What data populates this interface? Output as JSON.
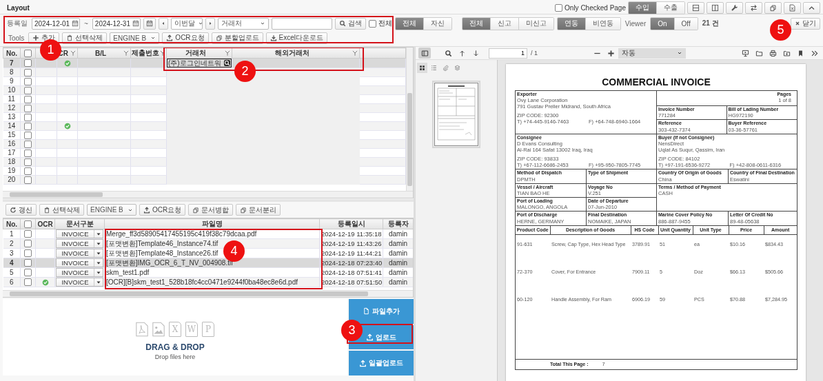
{
  "window": {
    "title": "Layout"
  },
  "top_right": {
    "only_checked": {
      "label": "Only Checked Page",
      "checked": false
    },
    "trade_toggle": [
      {
        "label": "수입",
        "selected": true
      },
      {
        "label": "수출",
        "selected": false
      }
    ]
  },
  "filter_bar": {
    "date_label": "등록일",
    "date_from": "2024-12-01",
    "separator": "~",
    "date_to": "2024-12-31",
    "period": "이번달",
    "partner_select": "거래처",
    "search_button": "검색",
    "all_checkbox": {
      "label": "전체",
      "checked": false
    },
    "scope_toggle": [
      {
        "label": "전체",
        "selected": true
      },
      {
        "label": "자신",
        "selected": false
      }
    ],
    "report_toggle": [
      {
        "label": "전체",
        "selected": true
      },
      {
        "label": "신고",
        "selected": false
      },
      {
        "label": "미신고",
        "selected": false
      }
    ],
    "link_toggle": [
      {
        "label": "연동",
        "selected": true
      },
      {
        "label": "비연동",
        "selected": false
      }
    ],
    "viewer_label": "Viewer",
    "viewer_toggle": [
      {
        "label": "On",
        "selected": true
      },
      {
        "label": "Off",
        "selected": false
      }
    ],
    "count": "21 건"
  },
  "close_button": "닫기",
  "tools": {
    "label": "Tools",
    "buttons": [
      {
        "kind": "button",
        "label": "추가"
      },
      {
        "kind": "button",
        "label": "선택삭제"
      },
      {
        "kind": "select",
        "label": "ENGINE B"
      },
      {
        "kind": "button",
        "label": "OCR요청"
      },
      {
        "kind": "button",
        "label": "분할업로드"
      },
      {
        "kind": "button",
        "label": "Excel다운로드"
      }
    ]
  },
  "upper_grid": {
    "header_checked": false,
    "columns": [
      {
        "label": "No.",
        "filter": false
      },
      {},
      {
        "label": "CR",
        "filter": true
      },
      {
        "label": "B/L",
        "filter": true
      },
      {
        "label": "제출번호",
        "filter": true
      },
      {
        "label": "거래처",
        "filter": true
      },
      {
        "label": "해외거래처",
        "filter": true
      }
    ],
    "rows": [
      {
        "no": "7",
        "selected": true,
        "checked": false,
        "ocr_done": true,
        "partner": "(주)로그인네트워"
      },
      {
        "no": "8",
        "selected": false,
        "checked": false,
        "ocr_done": false
      },
      {
        "no": "9",
        "selected": false,
        "checked": false,
        "ocr_done": false
      },
      {
        "no": "10",
        "selected": false,
        "checked": false,
        "ocr_done": false
      },
      {
        "no": "11",
        "selected": false,
        "checked": false,
        "ocr_done": false
      },
      {
        "no": "12",
        "selected": false,
        "checked": false,
        "ocr_done": false
      },
      {
        "no": "13",
        "selected": false,
        "checked": false,
        "ocr_done": false
      },
      {
        "no": "14",
        "selected": false,
        "checked": false,
        "ocr_done": true
      },
      {
        "no": "15",
        "selected": false,
        "checked": false,
        "ocr_done": false
      },
      {
        "no": "16",
        "selected": false,
        "checked": false,
        "ocr_done": false
      },
      {
        "no": "17",
        "selected": false,
        "checked": false,
        "ocr_done": false
      },
      {
        "no": "18",
        "selected": false,
        "checked": false,
        "ocr_done": false
      },
      {
        "no": "19",
        "selected": false,
        "checked": false,
        "ocr_done": false
      },
      {
        "no": "20",
        "selected": false,
        "checked": false,
        "ocr_done": false
      }
    ]
  },
  "file_toolbar": {
    "buttons": [
      {
        "kind": "button",
        "label": "갱신"
      },
      {
        "kind": "button",
        "label": "선택삭제"
      },
      {
        "kind": "select",
        "label": "ENGINE B"
      },
      {
        "kind": "button",
        "label": "OCR요청"
      },
      {
        "kind": "button",
        "label": "문서병합"
      },
      {
        "kind": "button",
        "label": "문서분리"
      }
    ]
  },
  "file_grid": {
    "header_checked": false,
    "columns": [
      "No.",
      "OCR",
      "문서구분",
      "파일명",
      "등록일시",
      "등록자"
    ],
    "rows": [
      {
        "no": "1",
        "selected": false,
        "checked": false,
        "ocr_done": false,
        "doc_type": "INVOICE",
        "file": "Merge_ff3d58905417455195c419f38c79dcaa.pdf",
        "date": "2024-12-19 11:35:18",
        "user": "damin"
      },
      {
        "no": "2",
        "selected": false,
        "checked": false,
        "ocr_done": false,
        "doc_type": "INVOICE",
        "file": "[포맷변환]Template46_Instance74.tif",
        "date": "2024-12-19 11:43:26",
        "user": "damin"
      },
      {
        "no": "3",
        "selected": false,
        "checked": false,
        "ocr_done": false,
        "doc_type": "INVOICE",
        "file": "[포맷변환]Template48_Instance26.tif",
        "date": "2024-12-19 11:44:21",
        "user": "damin"
      },
      {
        "no": "4",
        "selected": true,
        "checked": false,
        "ocr_done": false,
        "doc_type": "INVOICE",
        "file": "[포맷변환]IMG_OCR_6_T_NV_004908.tif",
        "date": "2024-12-18 07:23:40",
        "user": "damin"
      },
      {
        "no": "5",
        "selected": false,
        "checked": false,
        "ocr_done": false,
        "doc_type": "INVOICE",
        "file": "skm_test1.pdf",
        "date": "2024-12-18 07:51:41",
        "user": "damin"
      },
      {
        "no": "6",
        "selected": false,
        "checked": false,
        "ocr_done": true,
        "doc_type": "INVOICE",
        "file": "[OCR][B]skm_test1_528b18fc4cc0471e9244f0ba48ec8e6d.pdf",
        "date": "2024-12-18 07:51:50",
        "user": "damin"
      }
    ]
  },
  "drop_zone": {
    "file_types": [
      {
        "kind": "pdf"
      },
      {
        "kind": "image"
      },
      {
        "kind": "letter",
        "letter": "X"
      },
      {
        "kind": "letter",
        "letter": "W"
      },
      {
        "kind": "letter",
        "letter": "P"
      }
    ],
    "title": "DRAG & DROP",
    "hint": "Drop files here"
  },
  "side_buttons": [
    "파일추가",
    "업로드",
    "일괄업로드"
  ],
  "viewer": {
    "sidebar_open": true,
    "page": "1",
    "page_total": "/ 1",
    "zoom": "자동",
    "sidebar_tabs": [
      {
        "kind": "thumbnails",
        "selected": true
      },
      {
        "kind": "outline",
        "selected": false
      },
      {
        "kind": "attachments",
        "selected": false
      },
      {
        "kind": "layers",
        "selected": false
      }
    ]
  },
  "invoice": {
    "title": "COMMERCIAL INVOICE",
    "exporter": {
      "label": "Exporter",
      "lines": [
        "Ovy Lane Corporation",
        "791 Gustav Preller Midrand, South Africa"
      ],
      "zip": "ZIP CODE: 92300",
      "tel": "T) +74-445-9146-7463",
      "fax": "F) +64-748-6940-1664"
    },
    "pages": {
      "label": "Pages",
      "value": "1 of 8"
    },
    "invoice_number": {
      "label": "Invoice Number",
      "value": "771284"
    },
    "bill_of_lading": {
      "label": "Bill of Lading Number",
      "value": "HG972190"
    },
    "reference": {
      "label": "Reference",
      "value": "303-432-7374"
    },
    "buyer_reference": {
      "label": "Buyer Reference",
      "value": "03-36-57761"
    },
    "consignee": {
      "label": "Consignee",
      "lines": [
        "D Evans Consulting",
        "Al-Rai 164 Safat 13002 Iraq, Iraq"
      ],
      "zip": "ZIP CODE: 93833",
      "tel": "T) +67-112-6686-2453",
      "fax": "F) +95-950-7805-7745"
    },
    "buyer": {
      "label": "Buyer (If not Consignee)",
      "lines": [
        "NensDirect",
        "Uqlat As Suqur, Qassim, Iran"
      ],
      "zip": "ZIP CODE: 84102",
      "tel": "T) +97-191-6536-9272",
      "fax": "F) +42-808-0611-6316"
    },
    "method_of_dispatch": {
      "label": "Method of Dispatch",
      "value": "DPMTH"
    },
    "type_of_shipment": {
      "label": "Type of Shipment"
    },
    "country_of_origin": {
      "label": "Country Of Origin of Goods",
      "value": "China"
    },
    "country_of_destination": {
      "label": "Country of Final Destination",
      "value": "Eswatini"
    },
    "vessel": {
      "label": "Vessel / Aircraft",
      "value": "TIAN BAO HE"
    },
    "voyage_no": {
      "label": "Voyage No",
      "value": "V.251"
    },
    "terms_of_payment": {
      "label": "Terms / Method of Payment",
      "value": "CASH"
    },
    "port_of_loading": {
      "label": "Port of Loading",
      "value": "MALONGO, ANGOLA"
    },
    "date_of_departure": {
      "label": "Date of Departure",
      "value": "07-Jun-2010"
    },
    "port_of_discharge": {
      "label": "Port of Discharge",
      "value": "HERNE, GERMANY"
    },
    "final_destination": {
      "label": "Final Destination",
      "value": "NOMAIKE, JAPAN"
    },
    "marine_cover_policy": {
      "label": "Marine Cover Policy No",
      "value": "886-887-9455"
    },
    "letter_of_credit": {
      "label": "Letter Of Credit No",
      "value": "89-48-05638"
    },
    "columns": [
      "Product Code",
      "Description of Goods",
      "HS Code",
      "Unit Quantity",
      "Unit Type",
      "Price",
      "Amount"
    ],
    "items": [
      [
        "91-631",
        "Screw, Cap Type, Hex Head Type",
        "3789.91",
        "51",
        "ea",
        "$10.16",
        "$834.43"
      ],
      [
        "72-370",
        "Cover, For Entrance",
        "7909.11",
        "5",
        "Doz",
        "$66.13",
        "$505.66"
      ],
      [
        "60-120",
        "Handle Assembly, For Ram",
        "6906.19",
        "59",
        "PCS",
        "$70.88",
        "$7,284.95"
      ]
    ],
    "total": {
      "label": "Total This Page :",
      "value": "7"
    }
  },
  "callouts": [
    {
      "number": "1"
    },
    {
      "number": "2"
    },
    {
      "number": "3"
    },
    {
      "number": "4"
    },
    {
      "number": "5"
    }
  ]
}
